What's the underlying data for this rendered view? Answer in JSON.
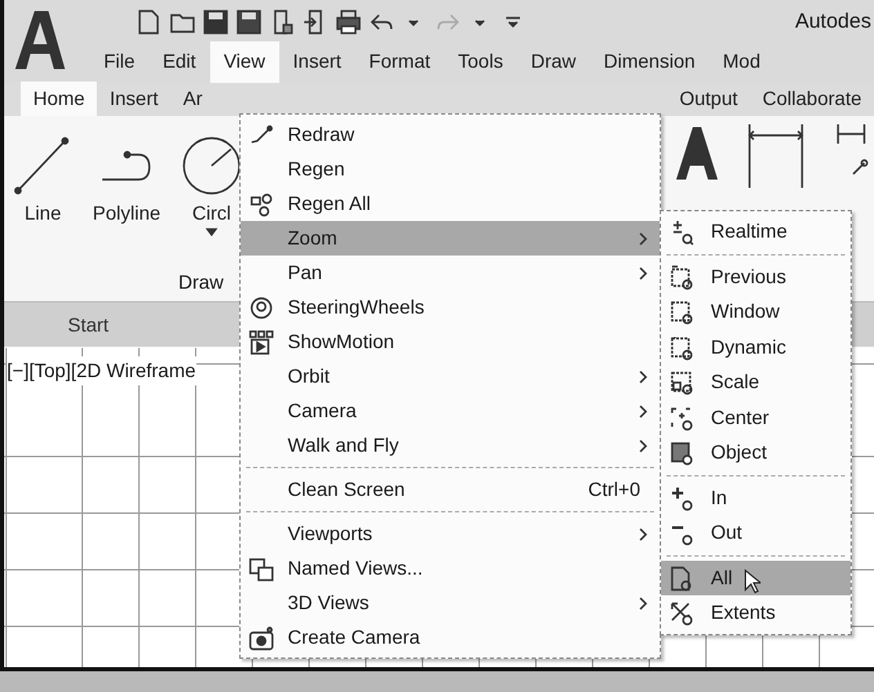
{
  "title_bar": {
    "title": "Autodes"
  },
  "menu_bar": [
    {
      "label": "File",
      "selected": false
    },
    {
      "label": "Edit",
      "selected": false
    },
    {
      "label": "View",
      "selected": true
    },
    {
      "label": "Insert",
      "selected": false
    },
    {
      "label": "Format",
      "selected": false
    },
    {
      "label": "Tools",
      "selected": false
    },
    {
      "label": "Draw",
      "selected": false
    },
    {
      "label": "Dimension",
      "selected": false
    },
    {
      "label": "Mod",
      "selected": false
    }
  ],
  "ribbon_tabs": [
    {
      "label": "Home",
      "selected": true
    },
    {
      "label": "Insert",
      "selected": false
    },
    {
      "label": "Ar",
      "selected": false
    },
    {
      "label": "Output",
      "selected": false
    },
    {
      "label": "Collaborate",
      "selected": false
    }
  ],
  "ribbon_tools": [
    {
      "label": "Line",
      "dropdown": false
    },
    {
      "label": "Polyline",
      "dropdown": false
    },
    {
      "label": "Circl",
      "dropdown": true
    }
  ],
  "ribbon_panel": {
    "title": "Draw"
  },
  "file_tabs": [
    {
      "label": "Start"
    }
  ],
  "viewport": {
    "label": "[−][Top][2D Wireframe"
  },
  "view_menu": [
    {
      "kind": "item",
      "label": "Redraw",
      "submenu": false,
      "selected": false
    },
    {
      "kind": "item",
      "label": "Regen",
      "submenu": false,
      "selected": false
    },
    {
      "kind": "item",
      "label": "Regen All",
      "submenu": false,
      "selected": false
    },
    {
      "kind": "item",
      "label": "Zoom",
      "submenu": true,
      "selected": true
    },
    {
      "kind": "item",
      "label": "Pan",
      "submenu": true,
      "selected": false
    },
    {
      "kind": "item",
      "label": "SteeringWheels",
      "submenu": false,
      "selected": false
    },
    {
      "kind": "item",
      "label": "ShowMotion",
      "submenu": false,
      "selected": false
    },
    {
      "kind": "item",
      "label": "Orbit",
      "submenu": true,
      "selected": false
    },
    {
      "kind": "item",
      "label": "Camera",
      "submenu": true,
      "selected": false
    },
    {
      "kind": "item",
      "label": "Walk and Fly",
      "submenu": true,
      "selected": false
    },
    {
      "kind": "separator"
    },
    {
      "kind": "item",
      "label": "Clean Screen",
      "shortcut": "Ctrl+0",
      "submenu": false,
      "selected": false
    },
    {
      "kind": "separator"
    },
    {
      "kind": "item",
      "label": "Viewports",
      "submenu": true,
      "selected": false
    },
    {
      "kind": "item",
      "label": "Named Views...",
      "submenu": false,
      "selected": false
    },
    {
      "kind": "item",
      "label": "3D Views",
      "submenu": true,
      "selected": false
    },
    {
      "kind": "item",
      "label": "Create Camera",
      "submenu": false,
      "selected": false
    }
  ],
  "zoom_submenu": [
    {
      "kind": "item",
      "label": "Realtime",
      "selected": false
    },
    {
      "kind": "separator"
    },
    {
      "kind": "item",
      "label": "Previous",
      "selected": false
    },
    {
      "kind": "item",
      "label": "Window",
      "selected": false
    },
    {
      "kind": "item",
      "label": "Dynamic",
      "selected": false
    },
    {
      "kind": "item",
      "label": "Scale",
      "selected": false
    },
    {
      "kind": "item",
      "label": "Center",
      "selected": false
    },
    {
      "kind": "item",
      "label": "Object",
      "selected": false
    },
    {
      "kind": "separator"
    },
    {
      "kind": "item",
      "label": "In",
      "selected": false
    },
    {
      "kind": "item",
      "label": "Out",
      "selected": false
    },
    {
      "kind": "separator"
    },
    {
      "kind": "item",
      "label": "All",
      "selected": true
    },
    {
      "kind": "item",
      "label": "Extents",
      "selected": false
    }
  ]
}
